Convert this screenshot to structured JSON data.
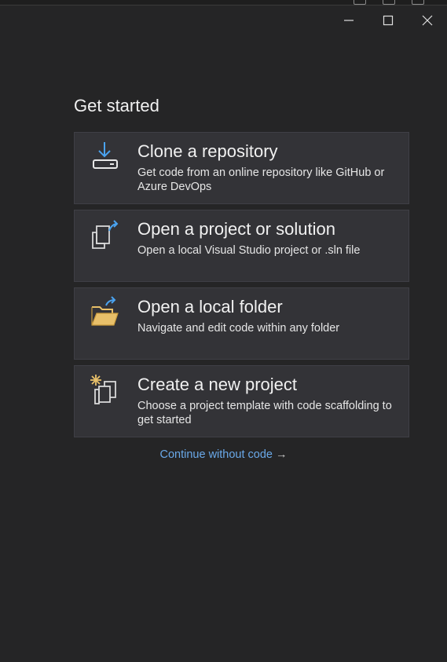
{
  "window": {
    "title_text": "Get started",
    "controls": {
      "minimize_icon": "minimize-icon",
      "maximize_icon": "maximize-icon",
      "close_icon": "close-icon"
    }
  },
  "cards": [
    {
      "title": "Clone a repository",
      "description": "Get code from an online repository like GitHub or Azure DevOps",
      "icon": "download-drive-icon"
    },
    {
      "title": "Open a project or solution",
      "description": "Open a local Visual Studio project or .sln file",
      "icon": "open-project-icon"
    },
    {
      "title": "Open a local folder",
      "description": "Navigate and edit code within any folder",
      "icon": "open-folder-icon"
    },
    {
      "title": "Create a new project",
      "description": "Choose a project template with code scaffolding to get started",
      "icon": "new-project-icon"
    }
  ],
  "continue_link": {
    "label": "Continue without code",
    "arrow": "→"
  },
  "colors": {
    "background": "#252526",
    "card": "#333337",
    "card_border": "#3f3f46",
    "accent_blue": "#4aa3f0",
    "link": "#6aa9e9",
    "folder_yellow": "#e8c06a"
  }
}
